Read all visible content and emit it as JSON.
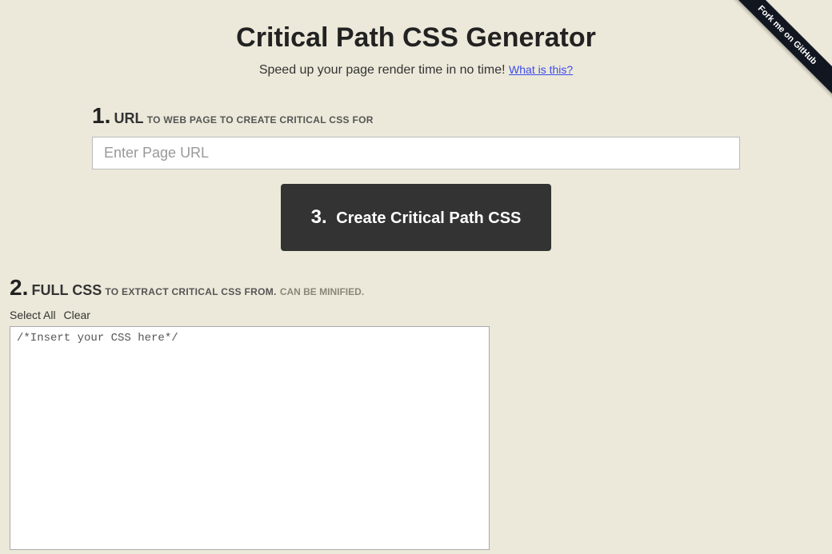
{
  "github_ribbon": "Fork me on GitHub",
  "header": {
    "title": "Critical Path CSS Generator",
    "subtitle": "Speed up your page render time in no time!",
    "what_link": "What is this?"
  },
  "step1": {
    "num": "1.",
    "name": "URL",
    "hint": "TO WEB PAGE TO CREATE CRITICAL CSS FOR",
    "placeholder": "Enter Page URL"
  },
  "button": {
    "num": "3.",
    "label": "Create Critical Path CSS"
  },
  "step2": {
    "num": "2.",
    "name": "FULL CSS",
    "hint": "TO EXTRACT CRITICAL CSS FROM.",
    "hint_soft": "CAN BE MINIFIED.",
    "select_all": "Select All",
    "clear": "Clear",
    "placeholder": "/*Insert your CSS here*/"
  }
}
